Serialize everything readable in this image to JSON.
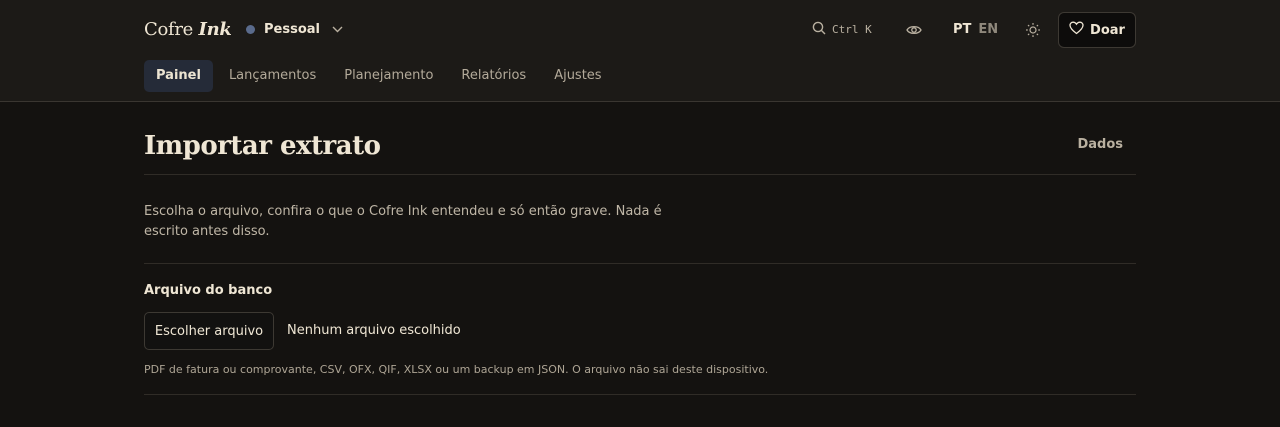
{
  "header": {
    "brand_main": "Cofre",
    "brand_accent": "Ink",
    "profile": {
      "label": "Pessoal",
      "dot_color": "#5a6b8c"
    },
    "search_shortcut": "Ctrl K",
    "lang_active": "PT",
    "lang_inactive": "EN",
    "donate_label": "Doar"
  },
  "nav": {
    "tabs": [
      {
        "label": "Painel",
        "active": true
      },
      {
        "label": "Lançamentos",
        "active": false
      },
      {
        "label": "Planejamento",
        "active": false
      },
      {
        "label": "Relatórios",
        "active": false
      },
      {
        "label": "Ajustes",
        "active": false
      }
    ]
  },
  "page": {
    "title": "Importar extrato",
    "action_link": "Dados",
    "intro": "Escolha o arquivo, confira o que o Cofre Ink entendeu e só então grave. Nada é escrito antes disso.",
    "field_label": "Arquivo do banco",
    "file_button": "Escolher arquivo",
    "file_status": "Nenhum arquivo escolhido",
    "hint": "PDF de fatura ou comprovante, CSV, OFX, QIF, XLSX ou um backup em JSON. O arquivo não sai deste dispositivo."
  },
  "icons": {
    "profile_chevron": "chevron-down-icon",
    "search": "search-icon",
    "privacy": "eye-icon",
    "theme": "sun-icon",
    "donate": "heart-icon"
  }
}
